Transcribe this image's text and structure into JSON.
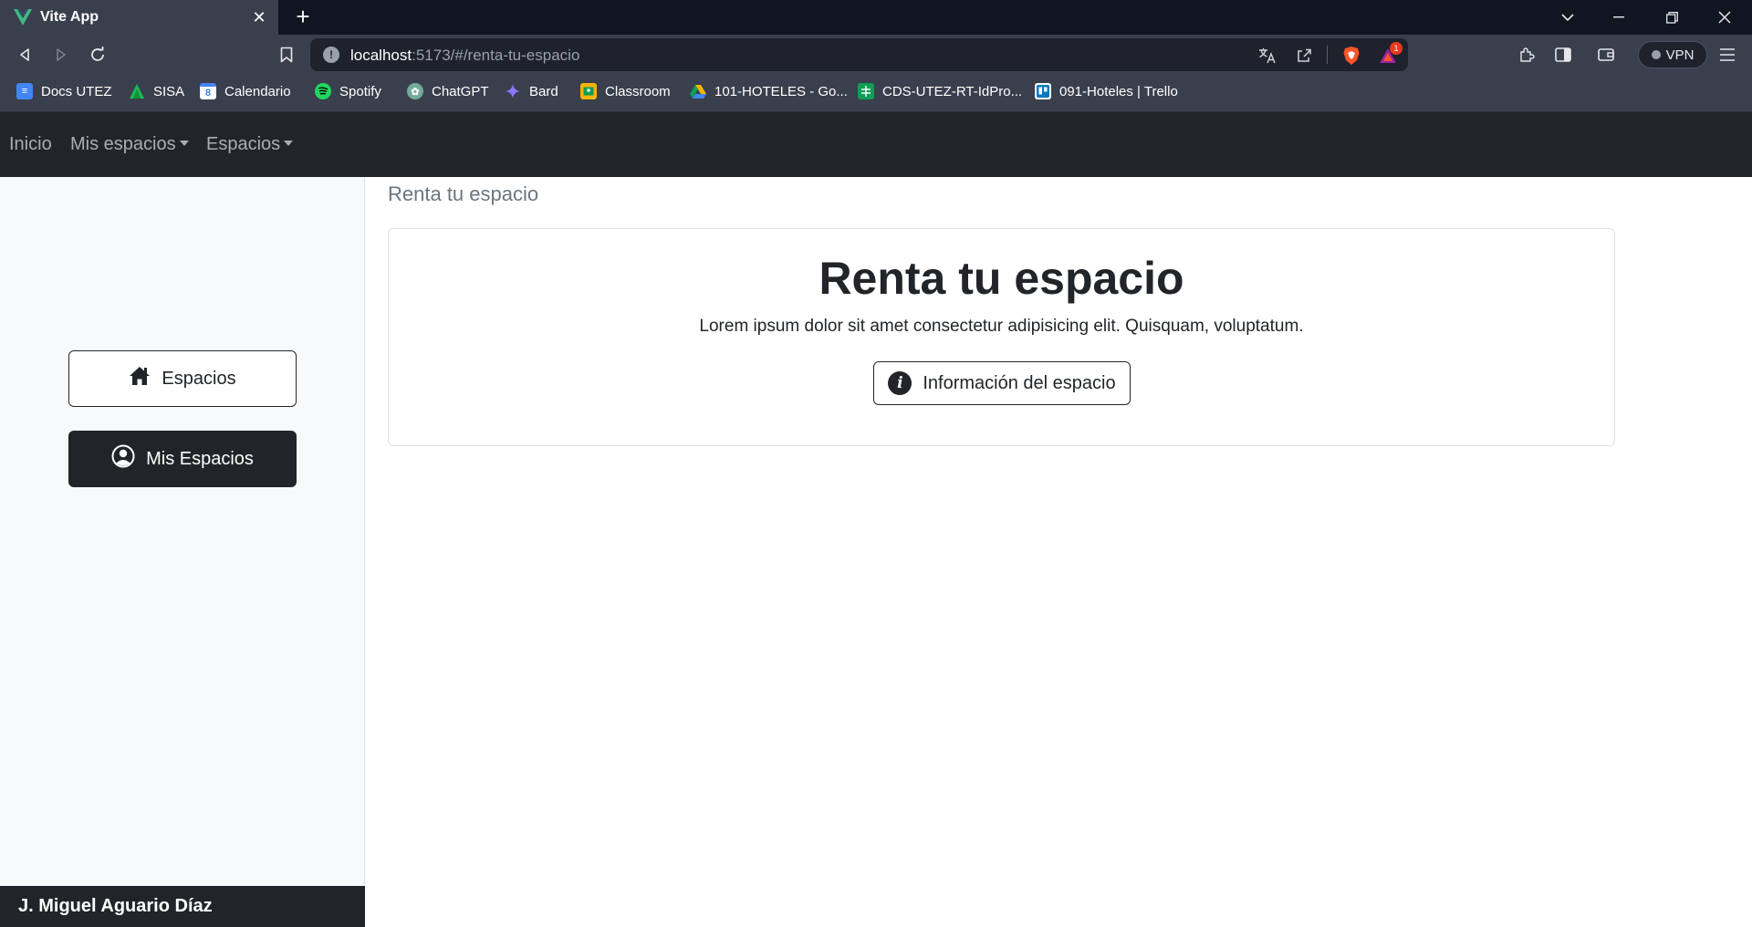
{
  "browser": {
    "tab_title": "Vite App",
    "tab_close": "✕",
    "new_tab": "+",
    "url_host": "localhost",
    "url_rest": ":5173/#/renta-tu-espacio",
    "vpn_label": "VPN",
    "notification_count": "1",
    "bookmarks": [
      {
        "label": "Docs UTEZ",
        "icon": "google-docs-icon",
        "color": "#4285f4"
      },
      {
        "label": "SISA",
        "icon": "sisa-icon",
        "color": "#1db954"
      },
      {
        "label": "Calendario",
        "icon": "google-calendar-icon",
        "color": "#4285f4"
      },
      {
        "label": "Spotify",
        "icon": "spotify-icon",
        "color": "#1ed760"
      },
      {
        "label": "ChatGPT",
        "icon": "chatgpt-icon",
        "color": "#74aa9c"
      },
      {
        "label": "Bard",
        "icon": "bard-icon",
        "color": "#8e75ff"
      },
      {
        "label": "Classroom",
        "icon": "google-classroom-icon",
        "color": "#f4b400"
      },
      {
        "label": "101-HOTELES - Go...",
        "icon": "google-drive-icon",
        "color": "#0f9d58"
      },
      {
        "label": "CDS-UTEZ-RT-IdPro...",
        "icon": "google-sheets-icon",
        "color": "#0f9d58"
      },
      {
        "label": "091-Hoteles | Trello",
        "icon": "trello-icon",
        "color": "#0079bf"
      }
    ]
  },
  "navbar": {
    "home": "Inicio",
    "my_spaces": "Mis espacios",
    "spaces": "Espacios"
  },
  "sidebar": {
    "spaces_button": "Espacios",
    "my_spaces_button": "Mis Espacios",
    "user_name": "J. Miguel Aguario Díaz"
  },
  "main": {
    "breadcrumb": "Renta tu espacio",
    "card_title": "Renta tu espacio",
    "card_text": "Lorem ipsum dolor sit amet consectetur adipisicing elit. Quisquam, voluptatum.",
    "info_button": "Información del espacio"
  },
  "colors": {
    "dark": "#212529",
    "chrome": "#3a3f4d",
    "light_bg": "#f8f9fa"
  }
}
